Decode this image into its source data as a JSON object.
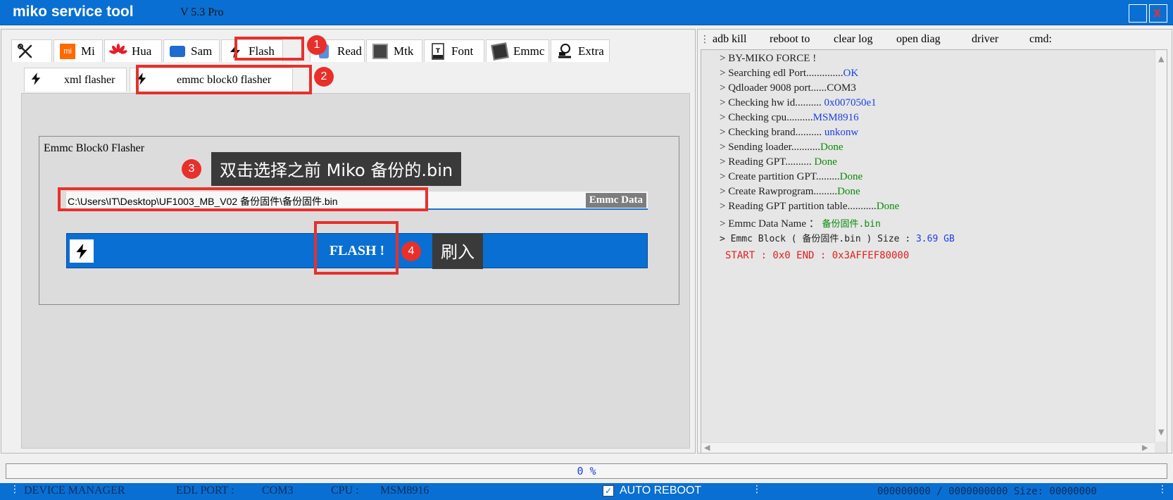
{
  "window": {
    "title": "miko service tool",
    "version": "V 5.3 Pro",
    "close_glyph": "x"
  },
  "tabs": [
    {
      "label": "",
      "icon": "tools-icon"
    },
    {
      "label": "Mi",
      "icon": "xiaomi-logo-icon"
    },
    {
      "label": "Hua",
      "icon": "huawei-logo-icon"
    },
    {
      "label": "Sam",
      "icon": "samsung-logo-icon"
    },
    {
      "label": "Flash",
      "icon": "lightning-icon"
    },
    {
      "label": "Read",
      "icon": "read-icon"
    },
    {
      "label": "Mtk",
      "icon": "chip-icon"
    },
    {
      "label": "Font",
      "icon": "font-file-icon"
    },
    {
      "label": "Emmc",
      "icon": "emmc-icon"
    },
    {
      "label": "Extra",
      "icon": "extra-icon"
    }
  ],
  "subtabs": [
    {
      "label": "xml flasher",
      "icon": "lightning-icon"
    },
    {
      "label": "emmc block0 flasher",
      "icon": "lightning-icon"
    }
  ],
  "block0": {
    "group_title": "Emmc Block0 Flasher",
    "path": "C:\\Users\\IT\\Desktop\\UF1003_MB_V02 备份固件\\备份固件.bin",
    "emmc_tag": "Emmc Data",
    "flash_button": "FLASH !"
  },
  "cmdbar": [
    "adb kill",
    "reboot to",
    "clear log",
    "open diag",
    "driver",
    "cmd:"
  ],
  "log": {
    "l1": "> BY-MIKO FORCE !",
    "l2k": "> Searching edl Port..............",
    "l2v": "OK",
    "l3k": "> Qdloader 9008 port......",
    "l3v": "COM3",
    "l4k": "> Checking hw id.......... ",
    "l4v": "0x007050e1",
    "l5k": "> Checking cpu..........",
    "l5v": "MSM8916",
    "l6k": "> Checking brand.......... ",
    "l6v": "unkonw",
    "l7k": "> Sending loader...........",
    "l7v": "Done",
    "l8k": "> Reading GPT.......... ",
    "l8v": "Done",
    "l9k": "> Create partition GPT.........",
    "l9v": "Done",
    "l10k": "> Create Rawprogram.........",
    "l10v": "Done",
    "l11k": "> Reading GPT partition table...........",
    "l11v": "Done",
    "l12k": "> Emmc Data Name ： ",
    "l12v": "备份固件.bin",
    "l13k": "> Emmc Block ( 备份固件.bin ) Size   :  ",
    "l13v": "3.69 GB",
    "l14": "START :  0x0   END :  0x3AFFEF80000"
  },
  "progress": {
    "text": "0 %",
    "value": 0
  },
  "status": {
    "device_manager": "DEVICE MANAGER",
    "edl_port_label": "EDL PORT :",
    "edl_port_value": "COM3",
    "cpu_label": "CPU :",
    "cpu_value": "MSM8916",
    "auto_reboot": "AUTO REBOOT",
    "auto_reboot_checked": true,
    "size_info": "000000000 / 0000000000 Size: 00000000"
  },
  "annotations": {
    "badge1": "1",
    "badge2": "2",
    "badge3": "3",
    "badge4": "4",
    "callout3": "双击选择之前 Miko 备份的.bin",
    "callout4": "刷入"
  },
  "colors": {
    "accent": "#0a6fd2",
    "annotation": "#e8302b",
    "log_ok": "#1a3fe6",
    "log_done": "#0a8a0a",
    "log_error": "#e02020"
  }
}
